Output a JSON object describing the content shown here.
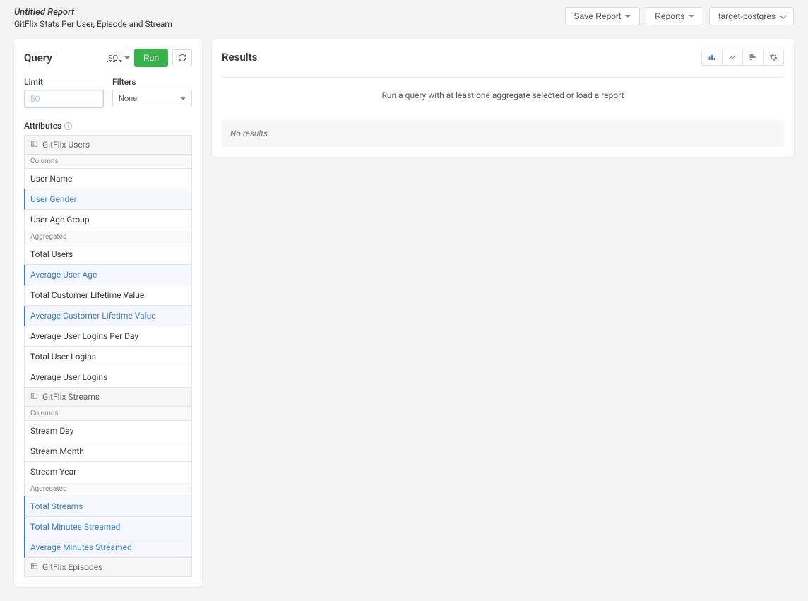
{
  "header": {
    "title": "Untitled Report",
    "subtitle": "GitFlix Stats Per User, Episode and Stream",
    "save_report": "Save Report",
    "reports": "Reports",
    "target": "target-postgres"
  },
  "query": {
    "title": "Query",
    "sql_link": "SQL",
    "run_label": "Run",
    "limit_label": "Limit",
    "limit_placeholder": "50",
    "filters_label": "Filters",
    "filters_value": "None",
    "attributes_label": "Attributes"
  },
  "attributes": [
    {
      "type": "group",
      "label": "GitFlix Users"
    },
    {
      "type": "sub",
      "label": "Columns"
    },
    {
      "type": "item",
      "label": "User Name",
      "selected": false
    },
    {
      "type": "item",
      "label": "User Gender",
      "selected": true
    },
    {
      "type": "item",
      "label": "User Age Group",
      "selected": false
    },
    {
      "type": "sub",
      "label": "Aggregates"
    },
    {
      "type": "item",
      "label": "Total Users",
      "selected": false
    },
    {
      "type": "item",
      "label": "Average User Age",
      "selected": true
    },
    {
      "type": "item",
      "label": "Total Customer Lifetime Value",
      "selected": false
    },
    {
      "type": "item",
      "label": "Average Customer Lifetime Value",
      "selected": true
    },
    {
      "type": "item",
      "label": "Average User Logins Per Day",
      "selected": false
    },
    {
      "type": "item",
      "label": "Total User Logins",
      "selected": false
    },
    {
      "type": "item",
      "label": "Average User Logins",
      "selected": false
    },
    {
      "type": "group",
      "label": "GitFlix Streams"
    },
    {
      "type": "sub",
      "label": "Columns"
    },
    {
      "type": "item",
      "label": "Stream Day",
      "selected": false
    },
    {
      "type": "item",
      "label": "Stream Month",
      "selected": false
    },
    {
      "type": "item",
      "label": "Stream Year",
      "selected": false
    },
    {
      "type": "sub",
      "label": "Aggregates"
    },
    {
      "type": "item",
      "label": "Total Streams",
      "selected": true
    },
    {
      "type": "item",
      "label": "Total Minutes Streamed",
      "selected": true
    },
    {
      "type": "item",
      "label": "Average Minutes Streamed",
      "selected": true
    },
    {
      "type": "group",
      "label": "GitFlix Episodes"
    }
  ],
  "results": {
    "title": "Results",
    "placeholder": "Run a query with at least one aggregate selected or load a report",
    "no_results": "No results"
  }
}
